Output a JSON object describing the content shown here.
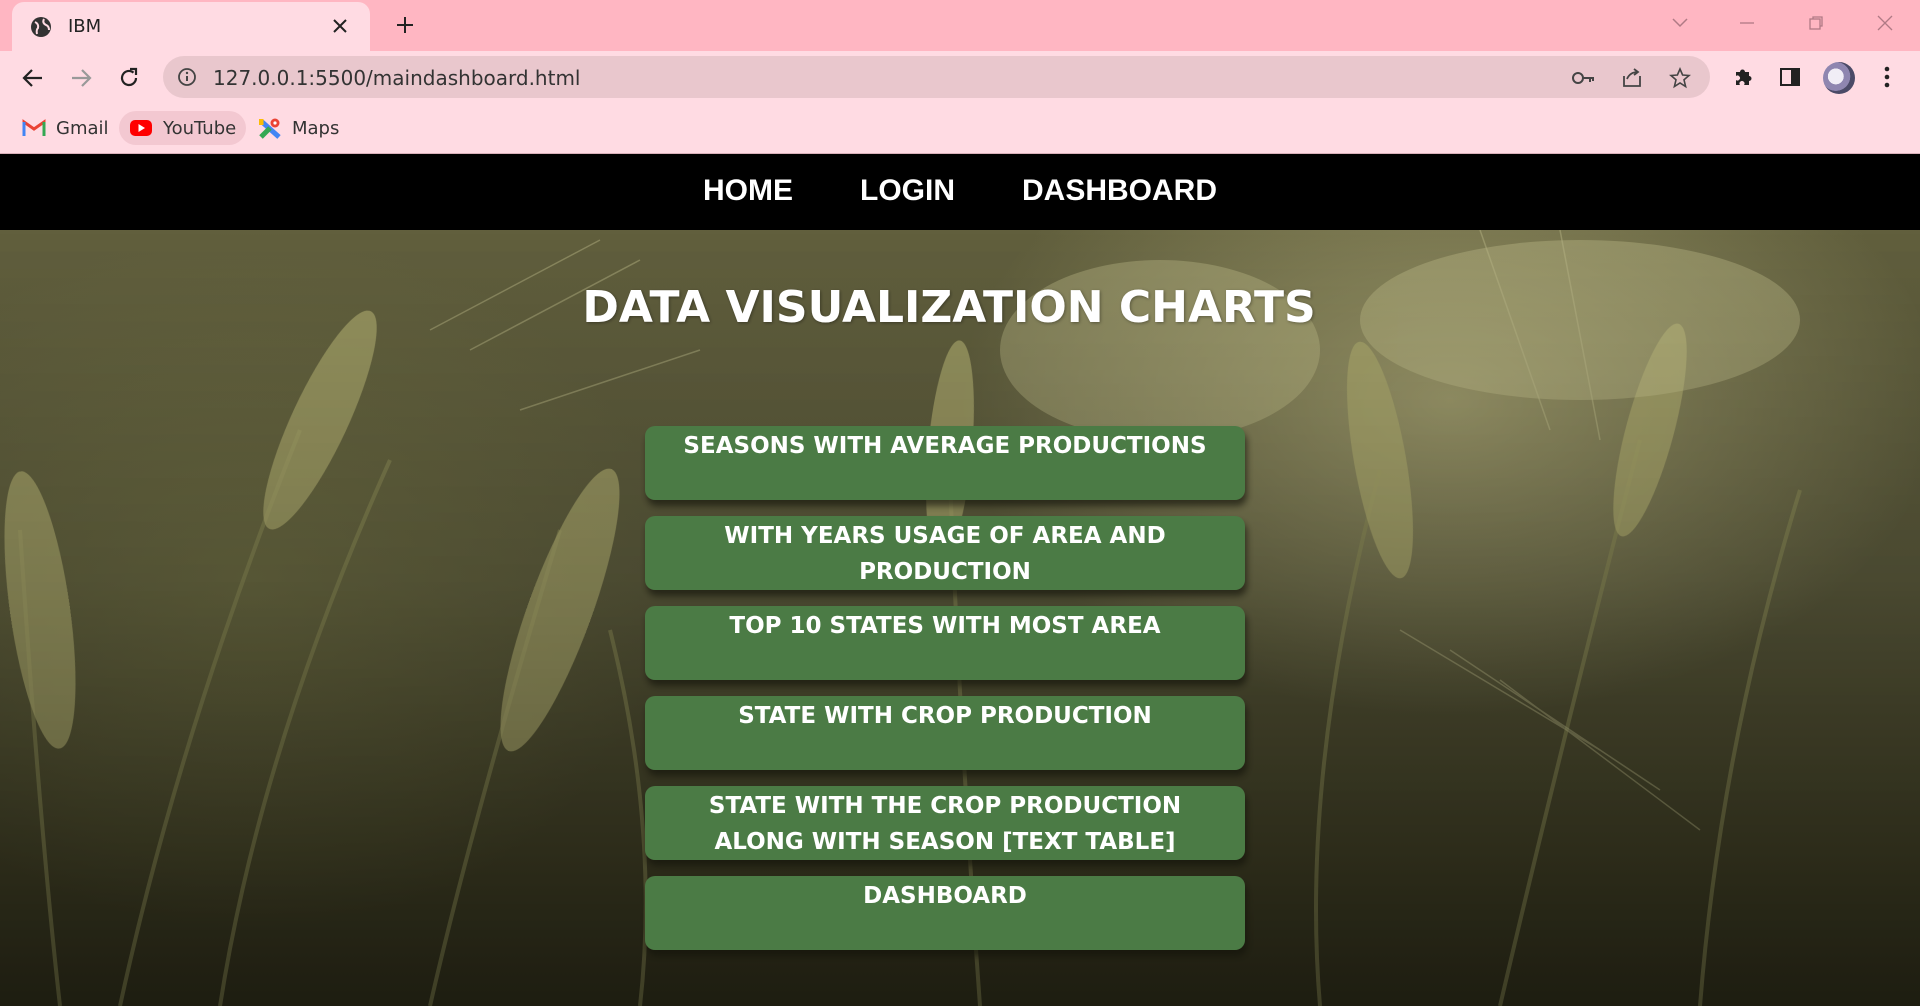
{
  "browser": {
    "tab_title": "IBM",
    "url": "127.0.0.1:5500/maindashboard.html",
    "bookmarks": [
      {
        "label": "Gmail",
        "icon": "gmail-icon"
      },
      {
        "label": "YouTube",
        "icon": "youtube-icon"
      },
      {
        "label": "Maps",
        "icon": "maps-icon"
      }
    ]
  },
  "navbar": {
    "home": "HOME",
    "login": "LOGIN",
    "dashboard": "DASHBOARD"
  },
  "main": {
    "title": "DATA VISUALIZATION CHARTS",
    "buttons": [
      "SEASONS WITH AVERAGE PRODUCTIONS",
      "WITH YEARS USAGE OF AREA AND PRODUCTION",
      "TOP 10 STATES WITH MOST AREA",
      "STATE WITH CROP PRODUCTION",
      "STATE WITH THE CROP PRODUCTION ALONG WITH SEASON [TEXT TABLE]",
      "DASHBOARD"
    ]
  },
  "colors": {
    "titlebar": "#ffb6c2",
    "toolbar": "#ffdbe3",
    "navbar": "#000000",
    "button": "#4b7b45"
  }
}
